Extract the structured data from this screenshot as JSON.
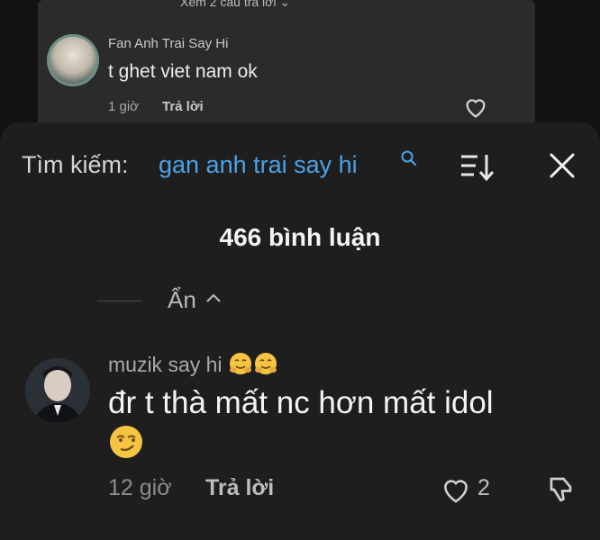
{
  "background_comment": {
    "more_replies": "Xem 2 câu trả lời",
    "author": "Fan Anh Trai Say Hi",
    "text": "t ghet viet nam ok",
    "time": "1 giờ",
    "reply": "Trả lời"
  },
  "sheet": {
    "search_label": "Tìm kiếm:",
    "search_query": "gan anh trai say hi",
    "comment_count": "466 bình luận",
    "hide_label": "Ẩn"
  },
  "comment": {
    "author": "muzik say hi",
    "text": "đr t thà mất nc hơn mất idol",
    "time": "12 giờ",
    "reply": "Trả lời",
    "likes": "2"
  },
  "colors": {
    "accent_search": "#4aa3e8",
    "sheet_bg": "#1e1e1e"
  },
  "icons": [
    "magnifier-icon",
    "sort-icon",
    "close-icon",
    "chevron-up-icon",
    "heart-icon",
    "dislike-icon",
    "hug-emoji",
    "smirk-emoji"
  ]
}
